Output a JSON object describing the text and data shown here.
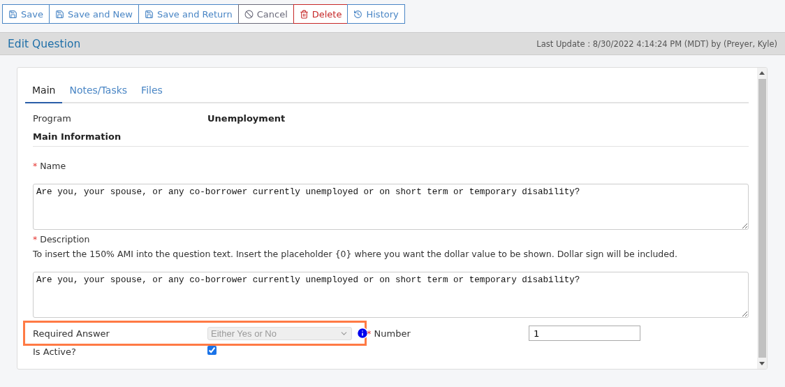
{
  "toolbar": [
    {
      "kind": "save",
      "label": "Save"
    },
    {
      "kind": "save",
      "label": "Save and New"
    },
    {
      "kind": "save",
      "label": "Save and Return"
    },
    {
      "kind": "cancel",
      "label": "Cancel"
    },
    {
      "kind": "delete",
      "label": "Delete"
    },
    {
      "kind": "history",
      "label": "History"
    }
  ],
  "header": {
    "title": "Edit Question",
    "last_update": "Last Update : 8/30/2022 4:14:24 PM (MDT) by (Preyer, Kyle)"
  },
  "tabs": [
    {
      "label": "Main",
      "selected": true
    },
    {
      "label": "Notes/Tasks",
      "selected": false
    },
    {
      "label": "Files",
      "selected": false
    }
  ],
  "program": {
    "label": "Program",
    "value": "Unemployment"
  },
  "section_title": "Main Information",
  "name_field": {
    "label": "Name",
    "required_mark": "*",
    "value": "Are you, your spouse, or any co-borrower currently unemployed or on short term or temporary disability?"
  },
  "description_field": {
    "label": "Description",
    "required_mark": "*",
    "hint": "To insert the 150% AMI into the question text. Insert the placeholder {0} where you want the dollar value to be shown. Dollar sign will be included.",
    "value": "Are you, your spouse, or any co-borrower currently unemployed or on short term or temporary disability?"
  },
  "required_answer": {
    "label": "Required Answer",
    "value": "Either Yes or No",
    "disabled": true,
    "highlighted": true
  },
  "number_field": {
    "label": "Number",
    "required_mark": "*",
    "value": "1"
  },
  "is_active": {
    "label": "Is Active?",
    "checked": true
  }
}
